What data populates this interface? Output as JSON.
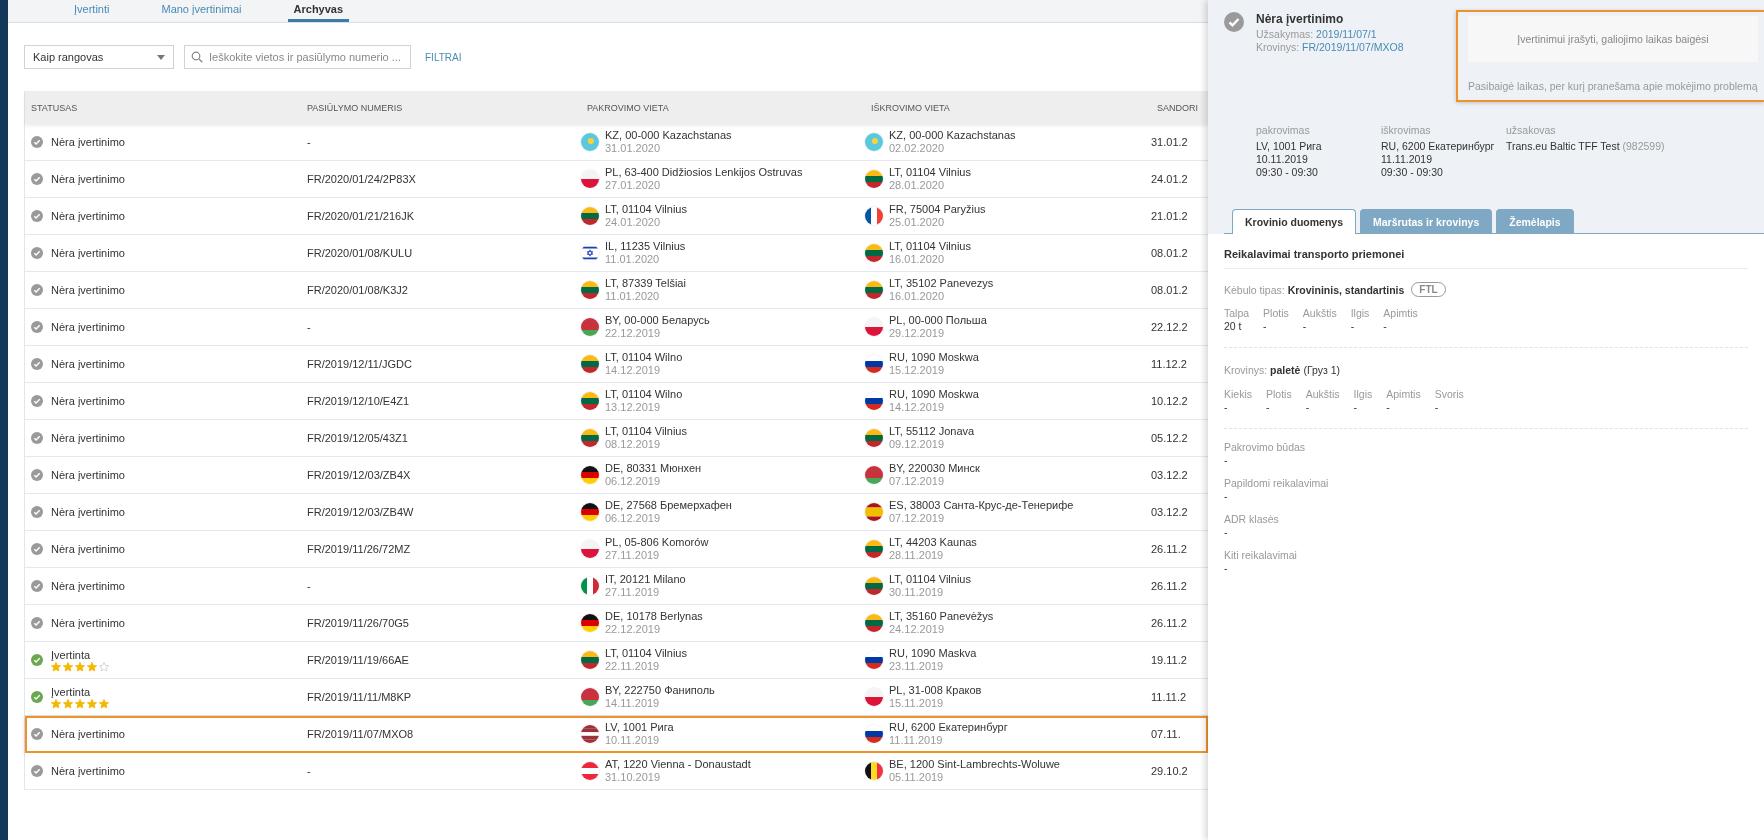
{
  "tabs": [
    {
      "label": "Įvertinti",
      "selected": false
    },
    {
      "label": "Mano įvertinimai",
      "selected": false
    },
    {
      "label": "Archyvas",
      "selected": true
    }
  ],
  "toolbar": {
    "role_select": "Kaip rangovas",
    "search": {
      "placeholder": "Ieškokite vietos ir pasiūlymo numerio ..."
    },
    "filters": "FILTRAI"
  },
  "table": {
    "columns": [
      "STATUSAS",
      "PASIŪLYMO NUMERIS",
      "PAKROVIMO VIETA",
      "IŠKROVIMO VIETA",
      "SANDORI"
    ],
    "rows": [
      {
        "kind": "unrated",
        "status": "Nėra įvertinimo",
        "number": "-",
        "loading": {
          "kind": "kz",
          "place": "KZ, 00-000 Kazachstanas",
          "date": "31.01.2020"
        },
        "unloading": {
          "kind": "kz",
          "place": "KZ, 00-000 Kazachstanas",
          "date": "02.02.2020"
        },
        "deal_date": "31.01.2",
        "selected": false
      },
      {
        "kind": "unrated",
        "status": "Nėra įvertinimo",
        "number": "FR/2020/01/24/2P83X",
        "loading": {
          "kind": "pl",
          "place": "PL, 63-400 Didžiosios Lenkijos Ostruvas",
          "date": "27.01.2020"
        },
        "unloading": {
          "kind": "lt",
          "place": "LT, 01104 Vilnius",
          "date": "28.01.2020"
        },
        "deal_date": "24.01.2",
        "selected": false
      },
      {
        "kind": "unrated",
        "status": "Nėra įvertinimo",
        "number": "FR/2020/01/21/216JK",
        "loading": {
          "kind": "lt",
          "place": "LT, 01104 Vilnius",
          "date": "24.01.2020"
        },
        "unloading": {
          "kind": "fr",
          "place": "FR, 75004 Paryžius",
          "date": "25.01.2020"
        },
        "deal_date": "21.01.2",
        "selected": false
      },
      {
        "kind": "unrated",
        "status": "Nėra įvertinimo",
        "number": "FR/2020/01/08/KULU",
        "loading": {
          "kind": "il",
          "place": "IL, 11235 Vilnius",
          "date": "11.01.2020"
        },
        "unloading": {
          "kind": "lt",
          "place": "LT, 01104 Vilnius",
          "date": "16.01.2020"
        },
        "deal_date": "08.01.2",
        "selected": false
      },
      {
        "kind": "unrated",
        "status": "Nėra įvertinimo",
        "number": "FR/2020/01/08/K3J2",
        "loading": {
          "kind": "lt",
          "place": "LT, 87339 Telšiai",
          "date": "11.01.2020"
        },
        "unloading": {
          "kind": "lt",
          "place": "LT, 35102 Panevezys",
          "date": "16.01.2020"
        },
        "deal_date": "08.01.2",
        "selected": false
      },
      {
        "kind": "unrated",
        "status": "Nėra įvertinimo",
        "number": "-",
        "loading": {
          "kind": "by",
          "place": "BY, 00-000 Беларусь",
          "date": "22.12.2019"
        },
        "unloading": {
          "kind": "pl",
          "place": "PL, 00-000 Польша",
          "date": "29.12.2019"
        },
        "deal_date": "22.12.2",
        "selected": false
      },
      {
        "kind": "unrated",
        "status": "Nėra įvertinimo",
        "number": "FR/2019/12/11/JGDC",
        "loading": {
          "kind": "lt",
          "place": "LT, 01104 Wilno",
          "date": "14.12.2019"
        },
        "unloading": {
          "kind": "ru",
          "place": "RU, 1090 Moskwa",
          "date": "15.12.2019"
        },
        "deal_date": "11.12.2",
        "selected": false
      },
      {
        "kind": "unrated",
        "status": "Nėra įvertinimo",
        "number": "FR/2019/12/10/E4Z1",
        "loading": {
          "kind": "lt",
          "place": "LT, 01104 Wilno",
          "date": "13.12.2019"
        },
        "unloading": {
          "kind": "ru",
          "place": "RU, 1090 Moskwa",
          "date": "14.12.2019"
        },
        "deal_date": "10.12.2",
        "selected": false
      },
      {
        "kind": "unrated",
        "status": "Nėra įvertinimo",
        "number": "FR/2019/12/05/43Z1",
        "loading": {
          "kind": "lt",
          "place": "LT, 01104 Vilnius",
          "date": "08.12.2019"
        },
        "unloading": {
          "kind": "lt",
          "place": "LT, 55112 Jonava",
          "date": "09.12.2019"
        },
        "deal_date": "05.12.2",
        "selected": false
      },
      {
        "kind": "unrated",
        "status": "Nėra įvertinimo",
        "number": "FR/2019/12/03/ZB4X",
        "loading": {
          "kind": "de",
          "place": "DE, 80331 Мюнхен",
          "date": "06.12.2019"
        },
        "unloading": {
          "kind": "by",
          "place": "BY, 220030 Минск",
          "date": "07.12.2019"
        },
        "deal_date": "03.12.2",
        "selected": false
      },
      {
        "kind": "unrated",
        "status": "Nėra įvertinimo",
        "number": "FR/2019/12/03/ZB4W",
        "loading": {
          "kind": "de",
          "place": "DE, 27568 Бремерхафен",
          "date": "06.12.2019"
        },
        "unloading": {
          "kind": "es",
          "place": "ES, 38003 Санта-Крус-де-Тенерифе",
          "date": "07.12.2019"
        },
        "deal_date": "03.12.2",
        "selected": false
      },
      {
        "kind": "unrated",
        "status": "Nėra įvertinimo",
        "number": "FR/2019/11/26/72MZ",
        "loading": {
          "kind": "pl",
          "place": "PL, 05-806 Komorów",
          "date": "27.11.2019"
        },
        "unloading": {
          "kind": "lt",
          "place": "LT, 44203 Kaunas",
          "date": "28.11.2019"
        },
        "deal_date": "26.11.2",
        "selected": false
      },
      {
        "kind": "unrated",
        "status": "Nėra įvertinimo",
        "number": "-",
        "loading": {
          "kind": "it",
          "place": "IT, 20121 Milano",
          "date": "27.11.2019"
        },
        "unloading": {
          "kind": "lt",
          "place": "LT, 01104 Vilnius",
          "date": "30.11.2019"
        },
        "deal_date": "26.11.2",
        "selected": false
      },
      {
        "kind": "unrated",
        "status": "Nėra įvertinimo",
        "number": "FR/2019/11/26/70G5",
        "loading": {
          "kind": "de",
          "place": "DE, 10178 Berlynas",
          "date": "22.12.2019"
        },
        "unloading": {
          "kind": "lt",
          "place": "LT, 35160 Panevėžys",
          "date": "24.12.2019"
        },
        "deal_date": "26.11.2",
        "selected": false
      },
      {
        "kind": "rated",
        "status": "Įvertinta",
        "stars": 4,
        "number": "FR/2019/11/19/66AE",
        "loading": {
          "kind": "lt",
          "place": "LT, 01104 Vilnius",
          "date": "22.11.2019"
        },
        "unloading": {
          "kind": "ru",
          "place": "RU, 1090 Maskva",
          "date": "23.11.2019"
        },
        "deal_date": "19.11.2",
        "selected": false
      },
      {
        "kind": "rated",
        "status": "Įvertinta",
        "stars": 5,
        "number": "FR/2019/11/11/M8KP",
        "loading": {
          "kind": "by",
          "place": "BY, 222750 Фаниполь",
          "date": "14.11.2019"
        },
        "unloading": {
          "kind": "pl",
          "place": "PL, 31-008 Краков",
          "date": "15.11.2019"
        },
        "deal_date": "11.11.2",
        "selected": false
      },
      {
        "kind": "unrated",
        "status": "Nėra įvertinimo",
        "number": "FR/2019/11/07/MXO8",
        "loading": {
          "kind": "lv",
          "place": "LV, 1001 Рига",
          "date": "10.11.2019"
        },
        "unloading": {
          "kind": "ru",
          "place": "RU, 6200 Екатеринбург",
          "date": "11.11.2019"
        },
        "deal_date": "07.11.",
        "selected": true
      },
      {
        "kind": "unrated",
        "status": "Nėra įvertinimo",
        "number": "-",
        "loading": {
          "kind": "at",
          "place": "AT, 1220 Vienna - Donaustadt",
          "date": "31.10.2019"
        },
        "unloading": {
          "kind": "be",
          "place": "BE, 1200 Sint-Lambrechts-Woluwe",
          "date": "05.11.2019"
        },
        "deal_date": "29.10.2",
        "selected": false
      }
    ]
  },
  "detail": {
    "status": "Nėra įvertinimo",
    "order_label": "Užsakymas:",
    "order_link": "2019/11/07/1",
    "cargo_label": "Krovinys:",
    "cargo_link": "FR/2019/11/07/MXO8",
    "notice": {
      "message": "Įvertinimui įrašyti, galiojimo laikas baigėsi",
      "note": "Pasibaigė laikas, per kurį pranešama apie mokėjimo problemą"
    },
    "summary": [
      {
        "label": "pakrovimas",
        "lines": [
          "LV, 1001 Рига",
          "10.11.2019",
          "09:30 - 09:30"
        ]
      },
      {
        "label": "iškrovimas",
        "lines": [
          "RU, 6200 Екатеринбург",
          "11.11.2019",
          "09:30 - 09:30"
        ]
      },
      {
        "label": "užsakovas",
        "lines": [
          "Trans.eu Baltic TFF Test"
        ],
        "suffix": "(982599)"
      }
    ],
    "tabs": [
      {
        "label": "Krovinio duomenys",
        "selected": true
      },
      {
        "label": "Maršrutas ir krovinys",
        "selected": false
      },
      {
        "label": "Žemėlapis",
        "selected": false
      }
    ],
    "section_title": "Reikalavimai transporto priemonei",
    "body_type": {
      "label": "Kėbulo tipas:",
      "value": "Krovininis, standartinis",
      "badge": "FTL"
    },
    "vehicle_specs": [
      {
        "label": "Talpa",
        "value": "20 t"
      },
      {
        "label": "Plotis",
        "value": "-"
      },
      {
        "label": "Aukštis",
        "value": "-"
      },
      {
        "label": "Ilgis",
        "value": "-"
      },
      {
        "label": "Apimtis",
        "value": "-"
      }
    ],
    "cargo": {
      "label": "Krovinys:",
      "value": "**paletė** (Груз 1)"
    },
    "cargo_specs": [
      {
        "label": "Kiekis",
        "value": "-"
      },
      {
        "label": "Plotis",
        "value": "-"
      },
      {
        "label": "Aukštis",
        "value": "-"
      },
      {
        "label": "Ilgis",
        "value": "-"
      },
      {
        "label": "Apimtis",
        "value": "-"
      },
      {
        "label": "Svoris",
        "value": "-"
      }
    ],
    "requirements": [
      {
        "label": "Pakrovimo būdas",
        "value": "-"
      },
      {
        "label": "Papildomi reikalavimai",
        "value": "-"
      },
      {
        "label": "ADR klasės",
        "value": "-"
      },
      {
        "label": "Kiti reikalavimai",
        "value": "-"
      }
    ]
  }
}
